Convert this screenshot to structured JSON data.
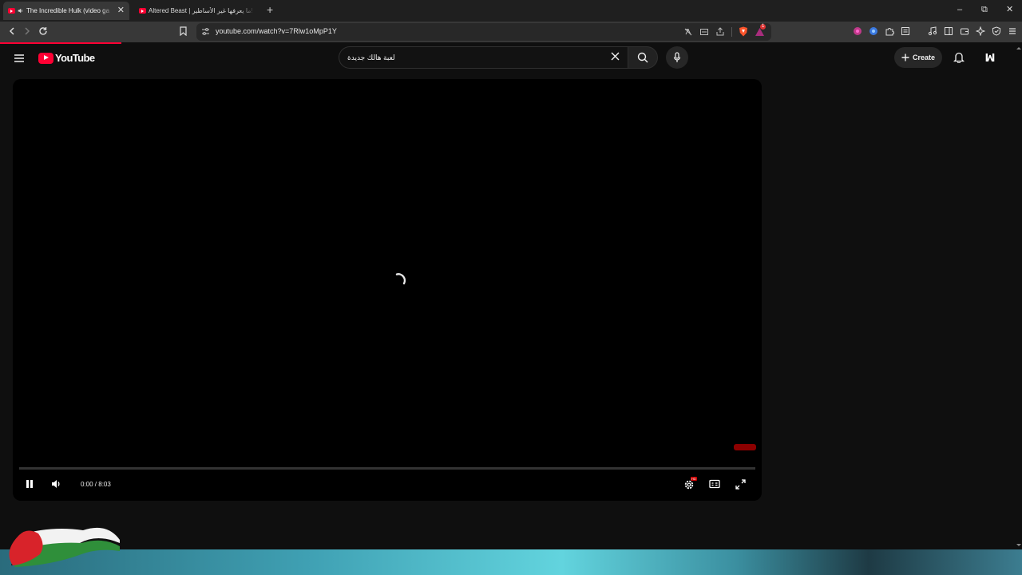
{
  "browser": {
    "tabs": [
      {
        "title": "The Incredible Hulk (video ga",
        "active": true,
        "close": "✕"
      },
      {
        "title": "Altered Beast | ما يعرفها غير الأساطير!",
        "active": false
      }
    ],
    "new_tab": "+",
    "window_controls": {
      "minimize": "–",
      "restore": "⧉",
      "close": "✕"
    },
    "url": "youtube.com/watch?v=7Rlw1oMpP1Y",
    "notification_count": "1"
  },
  "youtube": {
    "logo_text": "YouTube",
    "search_query": "لعبة هالك جديدة",
    "create_label": "Create",
    "avatar_glyph": "ꟽ"
  },
  "player": {
    "time_display": "0:00 / 8:03",
    "state": "loading",
    "progress": 0,
    "hd_badge": "HD"
  },
  "colors": {
    "brand_red": "#ff0033",
    "background": "#0f0f0f",
    "player_bg": "#000000",
    "ad_marker": "#8c0000"
  },
  "icons": [
    "back-icon",
    "forward-icon",
    "reload-icon",
    "bookmark-icon",
    "site-info-icon",
    "translate-icon",
    "cast-icon",
    "share-icon",
    "brave-shield-icon",
    "brave-rewards-icon",
    "extensions-icon",
    "media-icon",
    "sidebar-icon",
    "wallet-icon",
    "leo-icon",
    "vpn-icon",
    "menu-icon",
    "hamburger-icon",
    "search-icon",
    "clear-icon",
    "mic-icon",
    "plus-icon",
    "bell-icon",
    "pause-icon",
    "volume-icon",
    "settings-icon",
    "subtitles-icon",
    "fullscreen-icon",
    "spinner-icon"
  ]
}
